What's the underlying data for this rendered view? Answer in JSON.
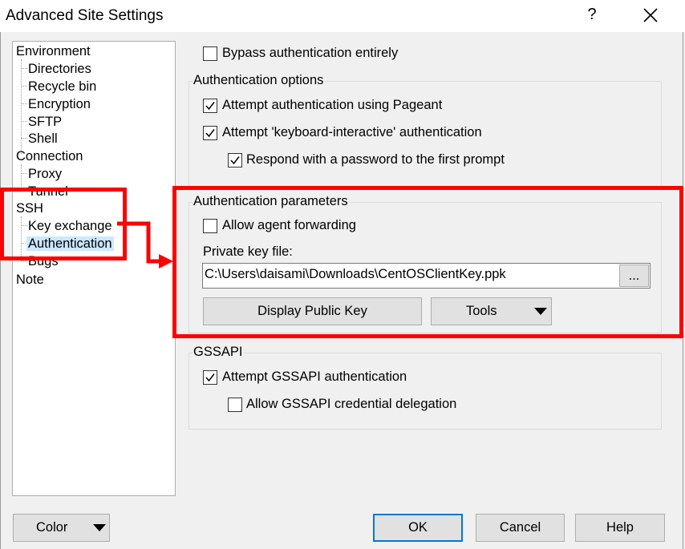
{
  "window": {
    "title": "Advanced Site Settings",
    "help_glyph": "?"
  },
  "tree": {
    "items": [
      {
        "label": "Environment",
        "level": 0
      },
      {
        "label": "Directories",
        "level": 1
      },
      {
        "label": "Recycle bin",
        "level": 1
      },
      {
        "label": "Encryption",
        "level": 1
      },
      {
        "label": "SFTP",
        "level": 1
      },
      {
        "label": "Shell",
        "level": 1
      },
      {
        "label": "Connection",
        "level": 0
      },
      {
        "label": "Proxy",
        "level": 1
      },
      {
        "label": "Tunnel",
        "level": 1
      },
      {
        "label": "SSH",
        "level": 0
      },
      {
        "label": "Key exchange",
        "level": 1
      },
      {
        "label": "Authentication",
        "level": 1,
        "selected": true
      },
      {
        "label": "Bugs",
        "level": 1
      },
      {
        "label": "Note",
        "level": 0
      }
    ]
  },
  "bypass": {
    "label": "Bypass authentication entirely",
    "checked": false
  },
  "auth_options": {
    "title": "Authentication options",
    "pageant": {
      "label": "Attempt authentication using Pageant",
      "checked": true
    },
    "keyboard_interactive": {
      "label": "Attempt 'keyboard-interactive' authentication",
      "checked": true
    },
    "respond_password": {
      "label": "Respond with a password to the first prompt",
      "checked": true
    }
  },
  "auth_params": {
    "title": "Authentication parameters",
    "agent_forwarding": {
      "label": "Allow agent forwarding",
      "checked": false
    },
    "private_key_label": "Private key file:",
    "private_key_value": "C:\\Users\\daisami\\Downloads\\CentOSClientKey.ppk",
    "browse_label": "...",
    "display_public_key": "Display Public Key",
    "tools": "Tools"
  },
  "gssapi": {
    "title": "GSSAPI",
    "attempt": {
      "label": "Attempt GSSAPI authentication",
      "checked": true
    },
    "delegation": {
      "label": "Allow GSSAPI credential delegation",
      "checked": false
    }
  },
  "footer": {
    "color": "Color",
    "ok": "OK",
    "cancel": "Cancel",
    "help": "Help"
  },
  "colors": {
    "annotation": "#ff0000",
    "selection": "#cce8ff",
    "default_button_border": "#0078d7"
  }
}
